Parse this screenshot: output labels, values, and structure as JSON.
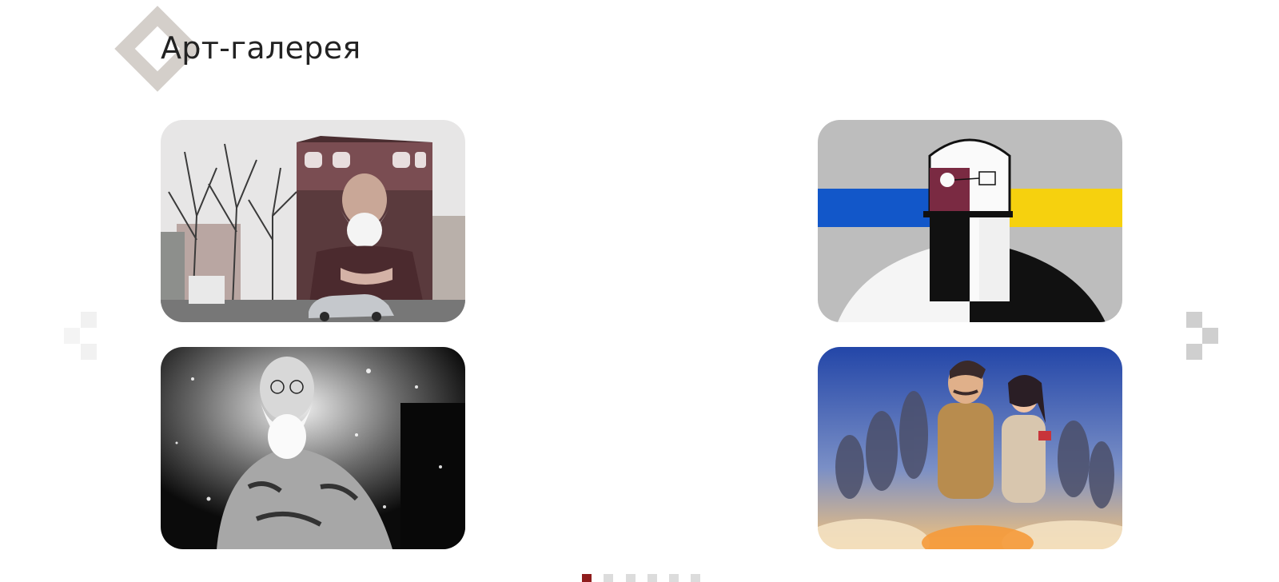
{
  "header": {
    "title": "Арт-галерея"
  },
  "gallery": {
    "items": [
      {
        "name": "mural-bearded-man-building"
      },
      {
        "name": "suprematist-figure-flag"
      },
      {
        "name": "tattooed-old-man-bw"
      },
      {
        "name": "illustrated-warriors-group"
      }
    ]
  },
  "pagination": {
    "total": 6,
    "active_index": 0
  },
  "colors": {
    "accent": "#8f1d1d",
    "title_text": "#222222",
    "diamond": "#d4cfca",
    "inactive_dot": "#dcdcdc",
    "ua_blue": "#1257c9",
    "ua_yellow": "#f6d10e"
  },
  "icons": {
    "prev": "chevron-left-pixel-icon",
    "next": "chevron-right-pixel-icon"
  }
}
